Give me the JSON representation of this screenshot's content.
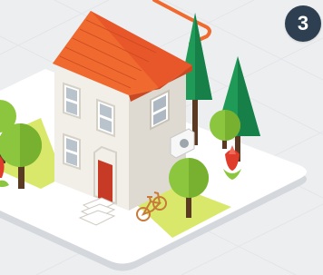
{
  "step_badge": {
    "number": "3"
  },
  "colors": {
    "background": "#eceef0",
    "platform": "#ffffff",
    "lawn": "#d9e86a",
    "roof": "#e8572a",
    "walls": "#f2efe9",
    "door": "#c63a26",
    "pipe": "#f06a2f",
    "tree_green": "#8cc63f",
    "pine_green": "#1f9a57",
    "badge_bg": "#2d3f50"
  },
  "icons": [
    "house-icon",
    "pine-tree-icon",
    "round-tree-icon",
    "bicycle-icon",
    "air-conditioner-icon",
    "tulip-icon"
  ]
}
